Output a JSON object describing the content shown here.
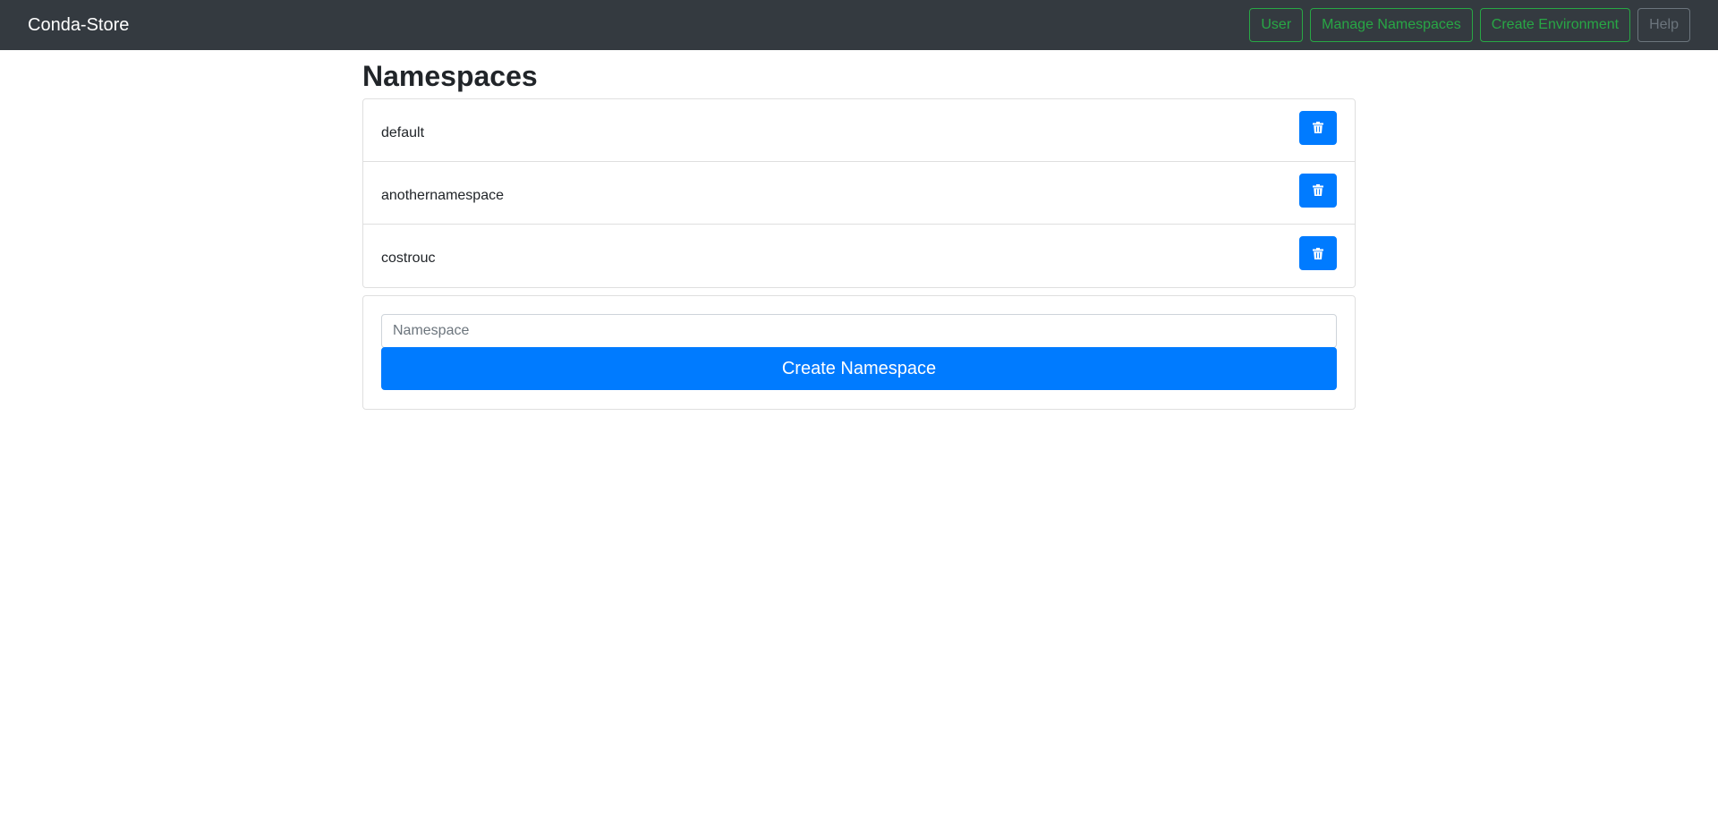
{
  "navbar": {
    "brand": "Conda-Store",
    "buttons": [
      {
        "label": "User",
        "style": "success"
      },
      {
        "label": "Manage Namespaces",
        "style": "success"
      },
      {
        "label": "Create Environment",
        "style": "success"
      },
      {
        "label": "Help",
        "style": "secondary"
      }
    ]
  },
  "page": {
    "title": "Namespaces"
  },
  "namespaces": [
    {
      "name": "default",
      "action_icon": "trash-icon"
    },
    {
      "name": "anothernamespace",
      "action_icon": "trash-icon"
    },
    {
      "name": "costrouc",
      "action_icon": "trash-icon"
    }
  ],
  "create_form": {
    "input_placeholder": "Namespace",
    "input_value": "",
    "submit_label": "Create Namespace"
  },
  "colors": {
    "navbar_bg": "#343a40",
    "success": "#28a745",
    "secondary": "#6c757d",
    "primary": "#007bff"
  }
}
